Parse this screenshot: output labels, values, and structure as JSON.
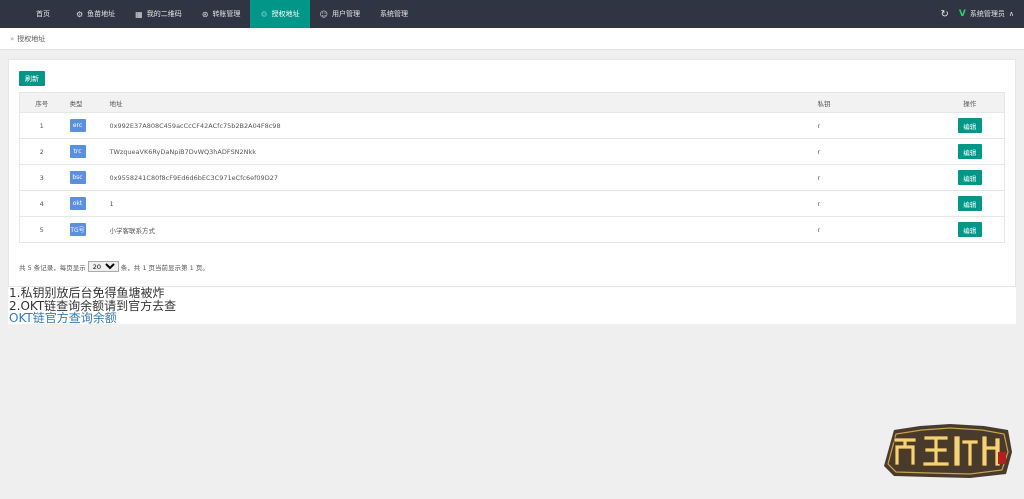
{
  "nav": {
    "items": [
      {
        "label": "首页",
        "icon": ""
      },
      {
        "label": "鱼苗地址",
        "icon": "link-icon"
      },
      {
        "label": "我的二维码",
        "icon": "qrcode-icon"
      },
      {
        "label": "转账管理",
        "icon": "transfer-icon"
      },
      {
        "label": "授权地址",
        "icon": "bulb-icon",
        "active": true
      },
      {
        "label": "用户管理",
        "icon": "user-icon"
      },
      {
        "label": "系统管理",
        "icon": ""
      }
    ],
    "admin_label": "系统管理员",
    "accent": "#009688",
    "bg": "#2f3542"
  },
  "breadcrumb": {
    "label": "授权地址"
  },
  "toolbar": {
    "refresh_label": "刷新"
  },
  "table": {
    "headers": [
      "序号",
      "类型",
      "地址",
      "私钥",
      "操作"
    ],
    "rows": [
      {
        "no": "1",
        "type": "erc",
        "address": "0x992E37A808C459acCcCF42ACfc75b2B2A04F8c98",
        "key": "r",
        "action": "编辑"
      },
      {
        "no": "2",
        "type": "trc",
        "address": "TWzqueaVK6RyDaNpiB7DvWQ3hADFSN2Nkk",
        "key": "r",
        "action": "编辑"
      },
      {
        "no": "3",
        "type": "bsc",
        "address": "0x9558241C80f8cF9Ed6d6bEC3C971eCfc6ef09D27",
        "key": "r",
        "action": "编辑"
      },
      {
        "no": "4",
        "type": "okt",
        "address": "1",
        "key": "r",
        "action": "编辑"
      },
      {
        "no": "5",
        "type": "TG号",
        "address": "小学客联系方式",
        "key": "r",
        "action": "编辑"
      }
    ]
  },
  "pager": {
    "prefix": "共 5 条记录，每页显示",
    "page_size": "20",
    "suffix": "条，共 1 页当前显示第 1 页。"
  },
  "notes": {
    "line1": "1.私钥别放后台免得鱼塘被炸",
    "line2": "2.OKT链查询余额请到官方去查",
    "link": "OKT链官方查询余额"
  },
  "logo": {
    "text": "南岳科技"
  }
}
